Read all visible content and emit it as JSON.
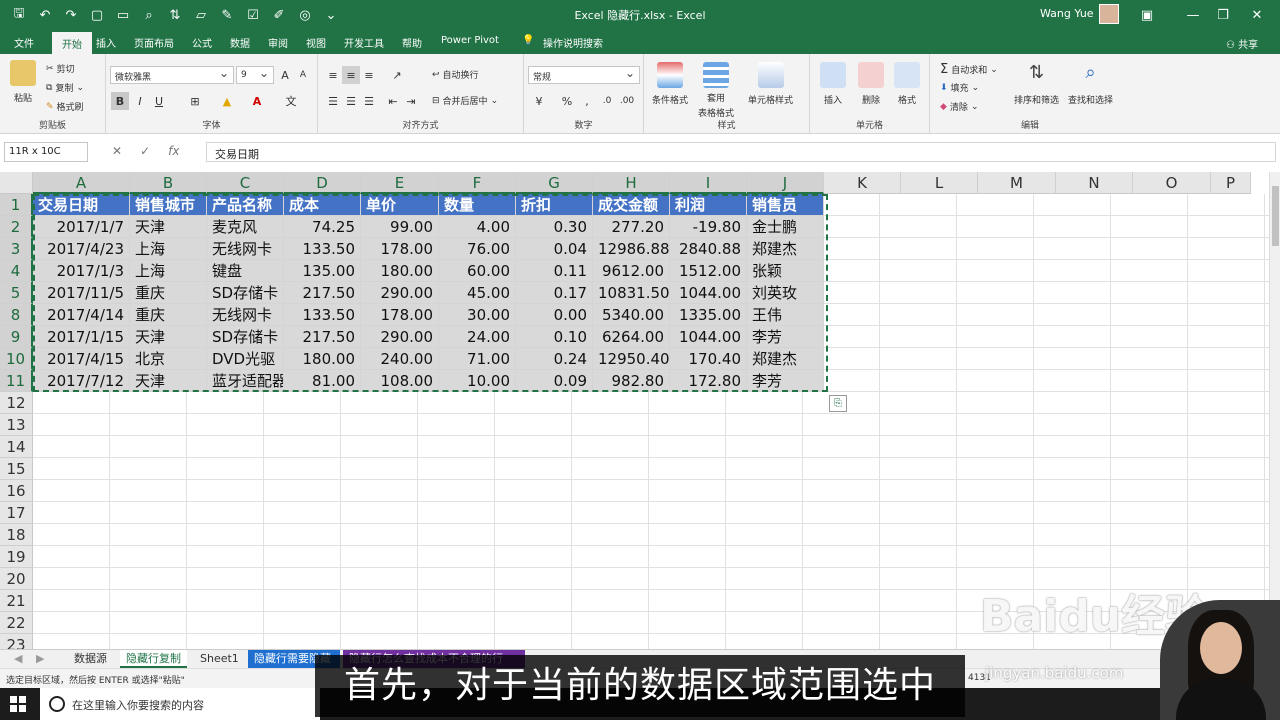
{
  "window": {
    "title": "Excel 隐藏行.xlsx - Excel",
    "user": "Wang Yue"
  },
  "ribbon_tabs": [
    "文件",
    "开始",
    "插入",
    "页面布局",
    "公式",
    "数据",
    "审阅",
    "视图",
    "开发工具",
    "帮助",
    "Power Pivot",
    "操作说明搜索"
  ],
  "share_label": "共享",
  "ribbon": {
    "clipboard": {
      "paste": "粘贴",
      "cut": "剪切",
      "copy": "复制",
      "format_painter": "格式刷",
      "label": "剪贴板"
    },
    "font": {
      "name": "微软雅黑",
      "size": "9",
      "label": "字体",
      "bold": "B",
      "italic": "I",
      "underline": "U"
    },
    "alignment": {
      "wrap": "自动换行",
      "merge": "合并后居中",
      "label": "对齐方式"
    },
    "number": {
      "format": "常规",
      "percent": "%",
      "comma": ",",
      "label": "数字"
    },
    "styles": {
      "conditional": "条件格式",
      "table_line1": "套用",
      "table_line2": "表格格式",
      "cell_style": "单元格样式",
      "label": "样式"
    },
    "cells": {
      "insert": "插入",
      "delete": "删除",
      "format": "格式",
      "label": "单元格"
    },
    "editing": {
      "autosum": "自动求和",
      "fill": "填充",
      "clear": "清除",
      "sort": "排序和筛选",
      "find": "查找和选择",
      "label": "编辑"
    }
  },
  "formula_bar": {
    "name_box": "11R x 10C",
    "fx": "fx",
    "content": "交易日期"
  },
  "columns": [
    "A",
    "B",
    "C",
    "D",
    "E",
    "F",
    "G",
    "H",
    "I",
    "J",
    "K",
    "L",
    "M",
    "N",
    "O",
    "P"
  ],
  "rows": [
    "1",
    "2",
    "3",
    "4",
    "5",
    "8",
    "9",
    "10",
    "11",
    "12",
    "13",
    "14",
    "15",
    "16",
    "17",
    "18",
    "19",
    "20",
    "21",
    "22",
    "23"
  ],
  "table": {
    "headers": [
      "交易日期",
      "销售城市",
      "产品名称",
      "成本",
      "单价",
      "数量",
      "折扣",
      "成交金额",
      "利润",
      "销售员"
    ],
    "rows": [
      [
        "2017/1/7",
        "天津",
        "麦克风",
        "74.25",
        "99.00",
        "4.00",
        "0.30",
        "277.20",
        "-19.80",
        "金士鹏"
      ],
      [
        "2017/4/23",
        "上海",
        "无线网卡",
        "133.50",
        "178.00",
        "76.00",
        "0.04",
        "12986.88",
        "2840.88",
        "郑建杰"
      ],
      [
        "2017/1/3",
        "上海",
        "键盘",
        "135.00",
        "180.00",
        "60.00",
        "0.11",
        "9612.00",
        "1512.00",
        "张颖"
      ],
      [
        "2017/11/5",
        "重庆",
        "SD存储卡",
        "217.50",
        "290.00",
        "45.00",
        "0.17",
        "10831.50",
        "1044.00",
        "刘英玫"
      ],
      [
        "2017/4/14",
        "重庆",
        "无线网卡",
        "133.50",
        "178.00",
        "30.00",
        "0.00",
        "5340.00",
        "1335.00",
        "王伟"
      ],
      [
        "2017/1/15",
        "天津",
        "SD存储卡",
        "217.50",
        "290.00",
        "24.00",
        "0.10",
        "6264.00",
        "1044.00",
        "李芳"
      ],
      [
        "2017/4/15",
        "北京",
        "DVD光驱",
        "180.00",
        "240.00",
        "71.00",
        "0.24",
        "12950.40",
        "170.40",
        "郑建杰"
      ],
      [
        "2017/7/12",
        "天津",
        "蓝牙适配器",
        "81.00",
        "108.00",
        "10.00",
        "0.09",
        "982.80",
        "172.80",
        "李芳"
      ]
    ]
  },
  "sheet_tabs": [
    "数据源",
    "隐藏行复制",
    "Sheet1",
    "隐藏行需要隐藏",
    "隐藏行怎么查找成本不合理的行"
  ],
  "status_message": "选定目标区域，然后按 ENTER 或选择\"粘贴\"",
  "status_fragment": "4131",
  "taskbar_search": "在这里输入你要搜索的内容",
  "subtitle": "首先，对于当前的数据区域范围选中",
  "watermark": {
    "brand": "Baidu经验",
    "url": "jingyan.baidu.com"
  },
  "colors": {
    "excel_green": "#217346",
    "table_header_blue": "#4472c4",
    "selection_gray": "#d9d9d9"
  }
}
